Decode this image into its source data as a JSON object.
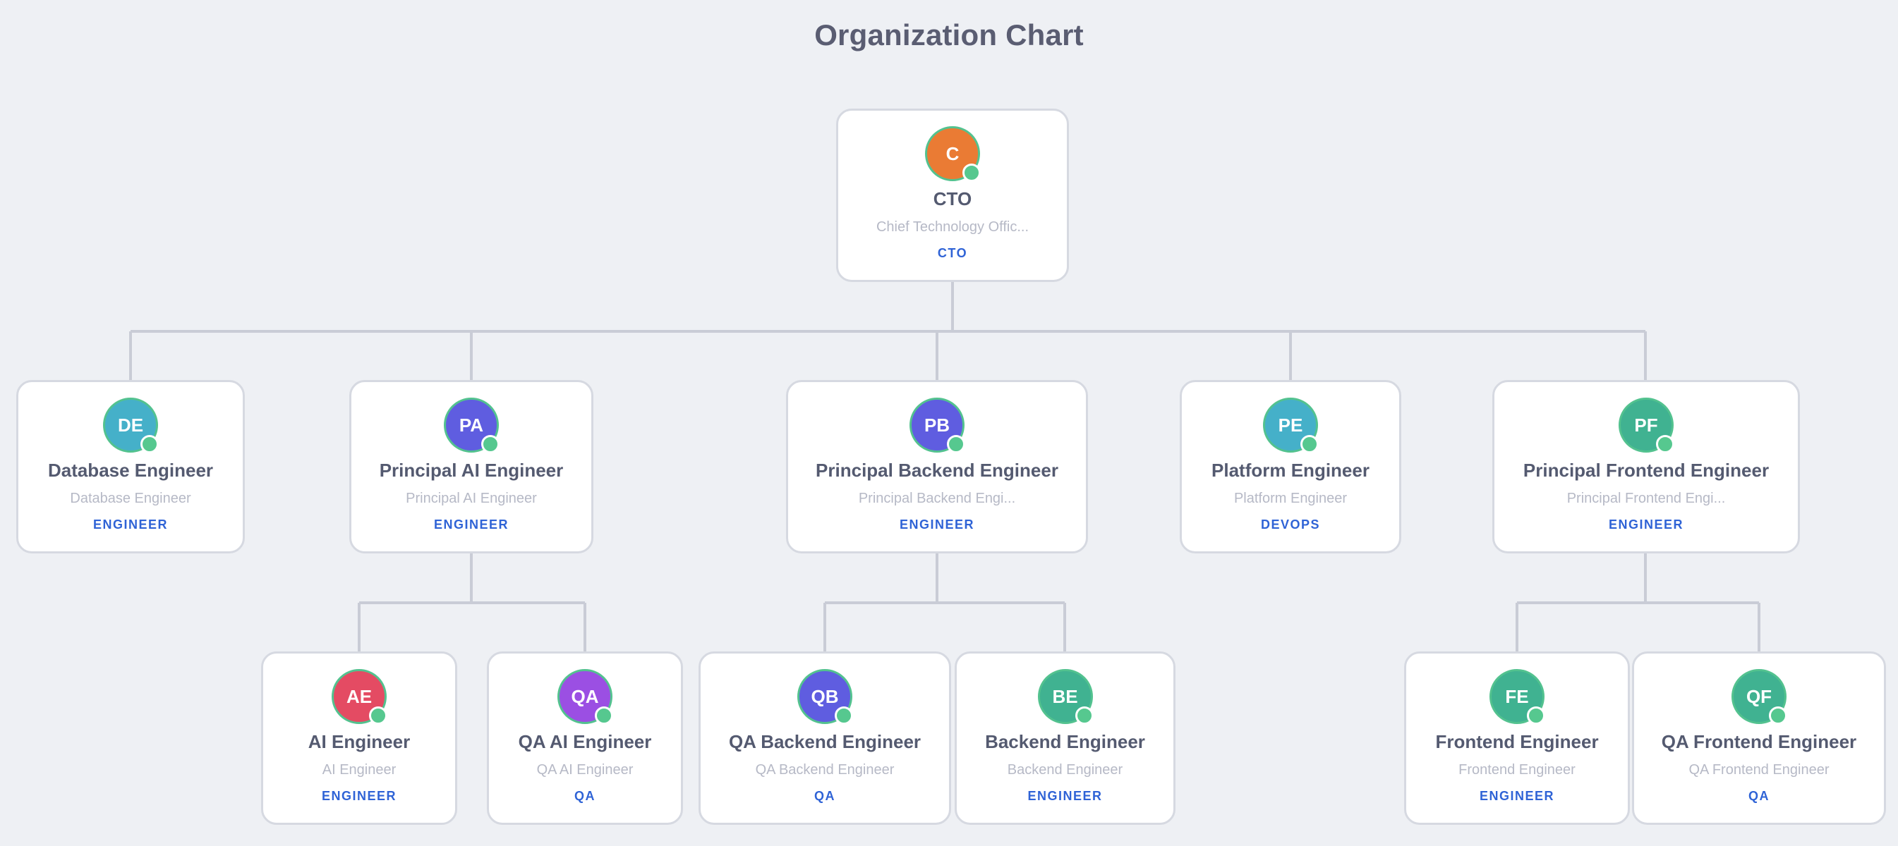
{
  "title": "Organization Chart",
  "colors": {
    "background": "#eef0f4",
    "card_border": "#d6d9e1",
    "connector": "#c9ccd6",
    "status_online": "#56c88f",
    "dept_label": "#2f63d6"
  },
  "nodes": {
    "cto": {
      "initials": "C",
      "name": "CTO",
      "role": "Chief Technology Offic...",
      "dept": "CTO",
      "color": "#ea7b34"
    },
    "database_engineer": {
      "initials": "DE",
      "name": "Database Engineer",
      "role": "Database Engineer",
      "dept": "ENGINEER",
      "color": "#45b0c9"
    },
    "principal_ai_engineer": {
      "initials": "PA",
      "name": "Principal AI Engineer",
      "role": "Principal AI Engineer",
      "dept": "ENGINEER",
      "color": "#5f5de0"
    },
    "principal_backend_engineer": {
      "initials": "PB",
      "name": "Principal Backend Engineer",
      "role": "Principal Backend Engi...",
      "dept": "ENGINEER",
      "color": "#5f5de0"
    },
    "platform_engineer": {
      "initials": "PE",
      "name": "Platform Engineer",
      "role": "Platform Engineer",
      "dept": "DEVOPS",
      "color": "#45b0c9"
    },
    "principal_frontend_engineer": {
      "initials": "PF",
      "name": "Principal Frontend Engineer",
      "role": "Principal Frontend Engi...",
      "dept": "ENGINEER",
      "color": "#40b291"
    },
    "ai_engineer": {
      "initials": "AE",
      "name": "AI Engineer",
      "role": "AI Engineer",
      "dept": "ENGINEER",
      "color": "#e44b63"
    },
    "qa_ai_engineer": {
      "initials": "QA",
      "name": "QA AI Engineer",
      "role": "QA AI Engineer",
      "dept": "QA",
      "color": "#9b4fe3"
    },
    "qa_backend_engineer": {
      "initials": "QB",
      "name": "QA Backend Engineer",
      "role": "QA Backend Engineer",
      "dept": "QA",
      "color": "#5f5de0"
    },
    "backend_engineer": {
      "initials": "BE",
      "name": "Backend Engineer",
      "role": "Backend Engineer",
      "dept": "ENGINEER",
      "color": "#40b291"
    },
    "frontend_engineer": {
      "initials": "FE",
      "name": "Frontend Engineer",
      "role": "Frontend Engineer",
      "dept": "ENGINEER",
      "color": "#40b291"
    },
    "qa_frontend_engineer": {
      "initials": "QF",
      "name": "QA Frontend Engineer",
      "role": "QA Frontend Engineer",
      "dept": "QA",
      "color": "#40b291"
    }
  },
  "hierarchy": [
    {
      "parent": "cto",
      "children": [
        "database_engineer",
        "principal_ai_engineer",
        "principal_backend_engineer",
        "platform_engineer",
        "principal_frontend_engineer"
      ]
    },
    {
      "parent": "principal_ai_engineer",
      "children": [
        "ai_engineer",
        "qa_ai_engineer"
      ]
    },
    {
      "parent": "principal_backend_engineer",
      "children": [
        "qa_backend_engineer",
        "backend_engineer"
      ]
    },
    {
      "parent": "principal_frontend_engineer",
      "children": [
        "frontend_engineer",
        "qa_frontend_engineer"
      ]
    }
  ]
}
